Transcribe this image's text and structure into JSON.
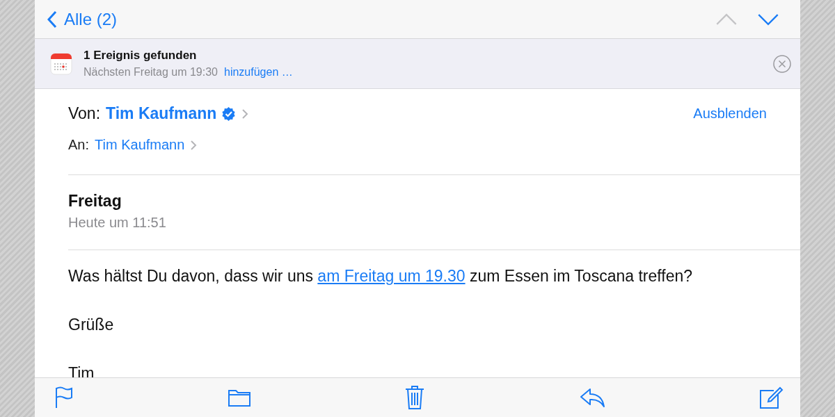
{
  "nav": {
    "back_label": "Alle (2)",
    "previous": {
      "disabled": true
    },
    "next": {
      "disabled": false
    }
  },
  "event_banner": {
    "title": "1 Ereignis gefunden",
    "detail": "Nächsten Freitag um 19:30",
    "action": "hinzufügen …"
  },
  "header": {
    "from_label": "Von:",
    "from": "Tim Kaufmann",
    "from_verified": true,
    "to_label": "An:",
    "to": "Tim Kaufmann",
    "hide": "Ausblenden"
  },
  "subject": "Freitag",
  "date": "Heute um 11:51",
  "body": [
    {
      "segments": [
        {
          "text": "Was hältst Du davon, dass wir uns ",
          "link": false
        },
        {
          "text": "am Freitag um 19.30",
          "link": true
        },
        {
          "text": " zum Essen im Toscana treffen?",
          "link": false
        }
      ]
    },
    {
      "segments": [
        {
          "text": "Grüße",
          "link": false
        }
      ]
    },
    {
      "segments": [
        {
          "text": "Tim",
          "link": false
        }
      ]
    }
  ],
  "toolbar": [
    {
      "kind": "flag"
    },
    {
      "kind": "folder"
    },
    {
      "kind": "trash"
    },
    {
      "kind": "reply"
    },
    {
      "kind": "compose"
    }
  ]
}
